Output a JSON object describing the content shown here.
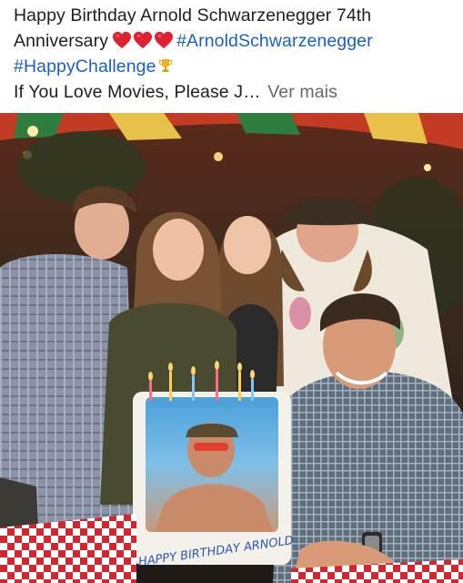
{
  "post": {
    "caption_line1": "Happy Birthday Arnold Schwarzenegger 74th",
    "caption_line2_text": "Anniversary",
    "hashtag_arnold": "#ArnoldSchwarzenegger",
    "hashtag_challenge": "#HappyChallenge",
    "caption_line4_text": "If You Love Movies, Please J…",
    "see_more": "Ver mais",
    "heart_count": 3
  },
  "photo": {
    "cake_text": "HAPPY BIRTHDAY ARNOLD"
  },
  "colors": {
    "hashtag": "#1a5fc4",
    "text": "#1c1e21",
    "muted": "#65676b",
    "heart": "#e0202e"
  },
  "icons": [
    "heart-icon",
    "trophy-icon"
  ]
}
